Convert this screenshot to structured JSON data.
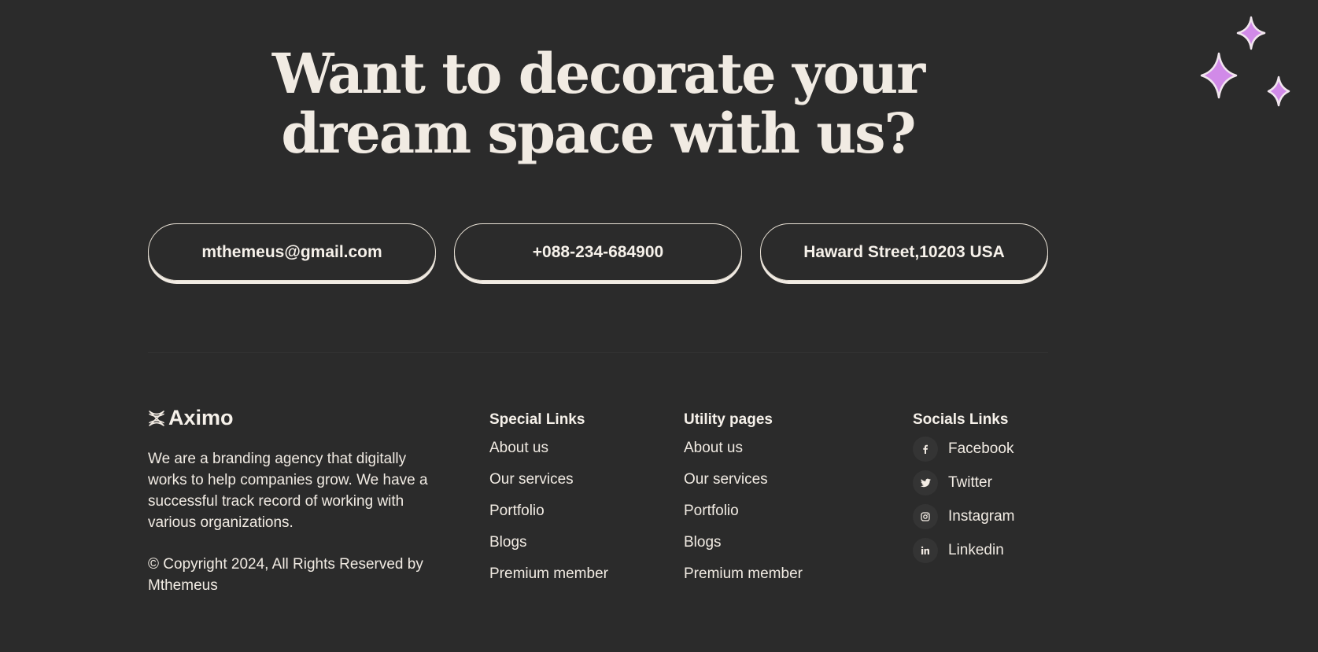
{
  "cta": {
    "headline_line1": "Want to decorate your",
    "headline_line2": "dream space with us?"
  },
  "contact": {
    "email": "mthemeus@gmail.com",
    "phone": "+088-234-684900",
    "address": "Haward Street,10203 USA"
  },
  "footer": {
    "brand": "Aximo",
    "about": "We are a branding agency that digitally works to help companies grow. We have a successful track record of working with various organizations.",
    "copyright": "© Copyright 2024, All Rights Reserved by Mthemeus",
    "special_links": {
      "title": "Special Links",
      "items": [
        "About us",
        "Our services",
        "Portfolio",
        "Blogs",
        "Premium member"
      ]
    },
    "utility_pages": {
      "title": "Utility pages",
      "items": [
        "About us",
        "Our services",
        "Portfolio",
        "Blogs",
        "Premium member"
      ]
    },
    "socials": {
      "title": "Socials Links",
      "items": [
        {
          "label": "Facebook",
          "icon": "facebook-icon"
        },
        {
          "label": "Twitter",
          "icon": "twitter-icon"
        },
        {
          "label": "Instagram",
          "icon": "instagram-icon"
        },
        {
          "label": "Linkedin",
          "icon": "linkedin-icon"
        }
      ]
    }
  },
  "colors": {
    "background": "#2b2b2b",
    "text": "#f3ece4",
    "sparkle": "#d18ae8"
  }
}
